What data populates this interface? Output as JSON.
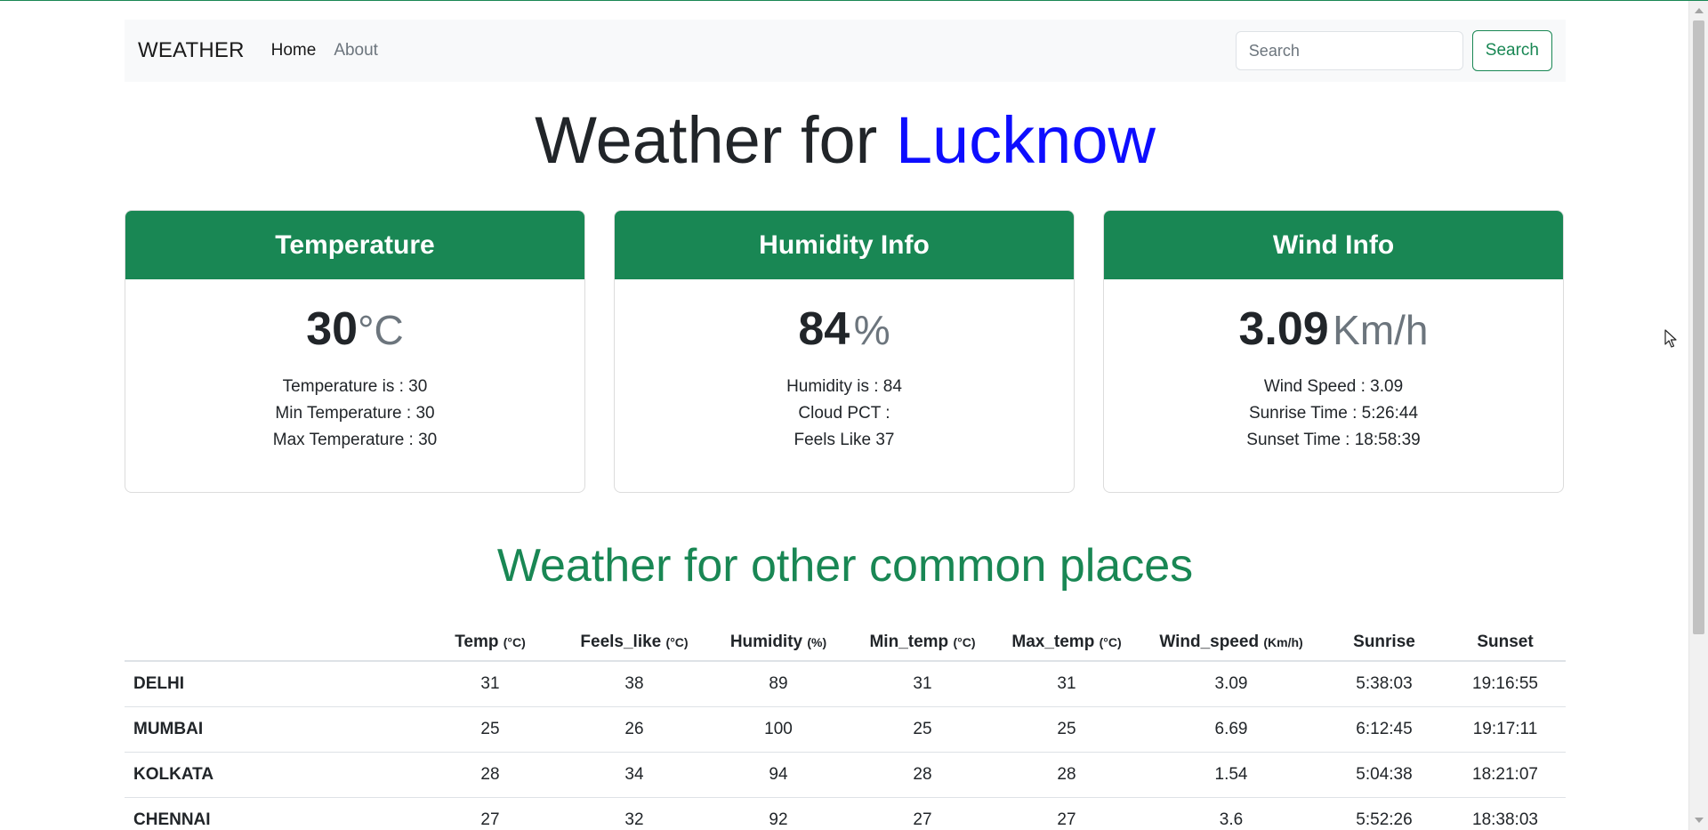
{
  "navbar": {
    "brand": "WEATHER",
    "links": [
      {
        "label": "Home"
      },
      {
        "label": "About"
      }
    ],
    "search": {
      "placeholder": "Search",
      "value": "",
      "button_label": "Search"
    }
  },
  "heading": {
    "prefix": "Weather for",
    "city": "Lucknow"
  },
  "cards": {
    "temperature": {
      "title": "Temperature",
      "value": "30",
      "unit": "°C",
      "lines": [
        "Temperature is : 30",
        "Min Temperature : 30",
        "Max Temperature : 30"
      ]
    },
    "humidity": {
      "title": "Humidity Info",
      "value": "84",
      "unit": "%",
      "lines": [
        "Humidity is : 84",
        "Cloud PCT :",
        "Feels Like 37"
      ]
    },
    "wind": {
      "title": "Wind Info",
      "value": "3.09",
      "unit": "Km/h",
      "lines": [
        "Wind Speed : 3.09",
        "Sunrise Time : 5:26:44",
        "Sunset Time : 18:58:39"
      ]
    }
  },
  "other_places": {
    "title": "Weather for other common places",
    "columns": [
      {
        "label": "",
        "unit": ""
      },
      {
        "label": "Temp",
        "unit": "(°C)"
      },
      {
        "label": "Feels_like",
        "unit": "(°C)"
      },
      {
        "label": "Humidity",
        "unit": "(%)"
      },
      {
        "label": "Min_temp",
        "unit": "(°C)"
      },
      {
        "label": "Max_temp",
        "unit": "(°C)"
      },
      {
        "label": "Wind_speed",
        "unit": "(Km/h)"
      },
      {
        "label": "Sunrise",
        "unit": ""
      },
      {
        "label": "Sunset",
        "unit": ""
      }
    ],
    "rows": [
      [
        "DELHI",
        "31",
        "38",
        "89",
        "31",
        "31",
        "3.09",
        "5:38:03",
        "19:16:55"
      ],
      [
        "MUMBAI",
        "25",
        "26",
        "100",
        "25",
        "25",
        "6.69",
        "6:12:45",
        "19:17:11"
      ],
      [
        "KOLKATA",
        "28",
        "34",
        "94",
        "28",
        "28",
        "1.54",
        "5:04:38",
        "18:21:07"
      ],
      [
        "CHENNAI",
        "27",
        "32",
        "92",
        "27",
        "27",
        "3.6",
        "5:52:26",
        "18:38:03"
      ]
    ]
  },
  "colors": {
    "brand_green": "#198754",
    "city_blue": "#0d0dff",
    "navbar_bg": "#f8f9fa"
  },
  "icons": {
    "cursor": "mouse-pointer-icon"
  }
}
